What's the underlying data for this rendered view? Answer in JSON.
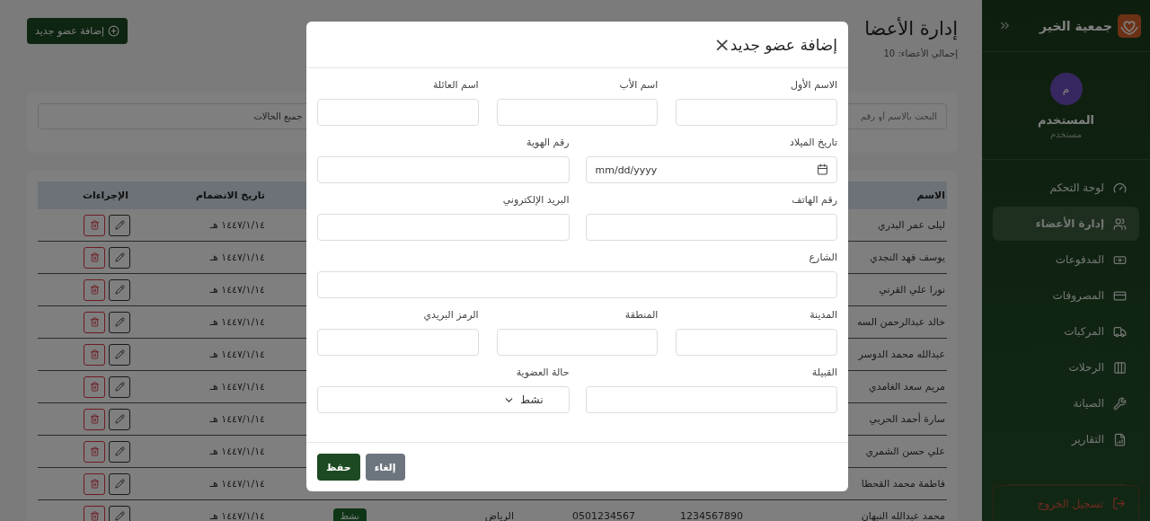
{
  "sidebar": {
    "brand": "جمعية الخير",
    "user": {
      "initial": "م",
      "name": "المستخدم",
      "role": "مستخدم"
    },
    "items": [
      {
        "label": "لوحة التحكم",
        "selected": false
      },
      {
        "label": "إدارة الأعضاء",
        "selected": true
      },
      {
        "label": "المدفوعات",
        "selected": false
      },
      {
        "label": "المصروفات",
        "selected": false
      },
      {
        "label": "المركبات",
        "selected": false
      },
      {
        "label": "الرحلات",
        "selected": false
      },
      {
        "label": "الصيانة",
        "selected": false
      },
      {
        "label": "التقارير",
        "selected": false
      }
    ],
    "logout": "تسجيل الخروج"
  },
  "header": {
    "title": "إدارة الأعضا",
    "subtitle": "إجمالي الأعضاء: 10",
    "add_button": "إضافة عضو جديد"
  },
  "filters": {
    "search_placeholder": "البحث بالاسم أو رقم",
    "status_select": "جميع الحالات"
  },
  "table": {
    "headers": {
      "name": "الاسم",
      "joined": "تاريخ الانضمام",
      "actions": "الإجراءات"
    },
    "rows": [
      {
        "name": "ليلى عمر البدري",
        "joined": "١٤٤٧/١/١٤ هـ"
      },
      {
        "name": "يوسف فهد النجدي",
        "joined": "١٤٤٧/١/١٤ هـ"
      },
      {
        "name": "نورا علي القرني",
        "joined": "١٤٤٧/١/١٤ هـ"
      },
      {
        "name": "خالد عبدالرحمن السه",
        "joined": "١٤٤٧/١/١٤ هـ"
      },
      {
        "name": "عبدالله محمد الدوسر",
        "joined": "١٤٤٧/١/١٤ هـ"
      },
      {
        "name": "مريم سعد الغامدي",
        "joined": "١٤٤٧/١/١٤ هـ"
      },
      {
        "name": "سارة أحمد الحربي",
        "joined": "١٤٤٧/١/١٤ هـ"
      },
      {
        "name": "علي حسن الشمري",
        "joined": "١٤٤٧/١/١٤ هـ"
      },
      {
        "name": "فاطمة محمد القحطا",
        "joined": "١٤٤٧/١/١٤ هـ"
      },
      {
        "name": "محمد عبدالله النبهان",
        "national_id": "1234567890",
        "phone": "0501234567",
        "city": "الرياض",
        "status": "نشط",
        "joined": "١٤٤٧/١/١٤ هـ"
      }
    ]
  },
  "modal": {
    "title": "إضافة عضو جديد",
    "close": "×",
    "rows": [
      [
        {
          "label": "الاسم الأول",
          "kind": "text"
        },
        {
          "label": "اسم الأب",
          "kind": "text"
        },
        {
          "label": "اسم العائلة",
          "kind": "text"
        }
      ],
      [
        {
          "label": "تاريخ الميلاد",
          "kind": "date",
          "placeholder": "mm/dd/yyyy"
        },
        {
          "label": "رقم الهوية",
          "kind": "text"
        }
      ],
      [
        {
          "label": "رقم الهاتف",
          "kind": "text"
        },
        {
          "label": "البريد الإلكتروني",
          "kind": "text"
        }
      ],
      [
        {
          "label": "الشارع",
          "kind": "text"
        }
      ],
      [
        {
          "label": "المدينة",
          "kind": "text"
        },
        {
          "label": "المنطقة",
          "kind": "text"
        },
        {
          "label": "الرمز البريدي",
          "kind": "text"
        }
      ],
      [
        {
          "label": "القبيلة",
          "kind": "text"
        },
        {
          "label": "حالة العضوية",
          "kind": "select",
          "value": "نشط"
        }
      ]
    ],
    "buttons": [
      {
        "label": "إلغاء",
        "kind": "secondary"
      },
      {
        "label": "حفظ",
        "kind": "primary"
      }
    ]
  }
}
